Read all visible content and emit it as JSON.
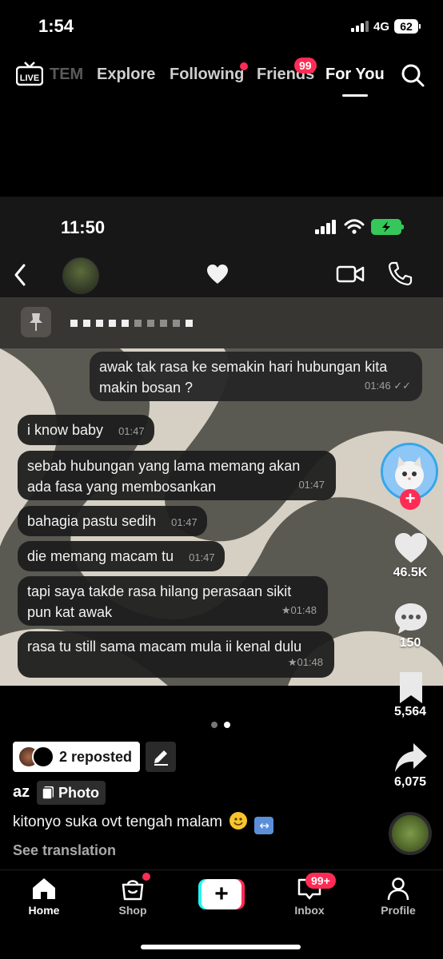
{
  "status_bar": {
    "time": "1:54",
    "network": "4G",
    "battery": "62"
  },
  "top_nav": {
    "live_label": "LIVE",
    "tabs": [
      "TEM",
      "Explore",
      "Following",
      "Friends",
      "For You"
    ],
    "friends_badge": "99",
    "active_tab": "For You"
  },
  "photo_post": {
    "inner_status_time": "11:50",
    "messages": [
      {
        "text": "awak tak rasa ke semakin hari hubungan kita makin bosan ?",
        "time": "01:46",
        "direction": "sent"
      },
      {
        "text": "i know baby",
        "time": "01:47",
        "direction": "received"
      },
      {
        "text": "sebab hubungan yang lama memang akan ada fasa yang membosankan",
        "time": "01:47",
        "direction": "received"
      },
      {
        "text": "bahagia pastu sedih",
        "time": "01:47",
        "direction": "received"
      },
      {
        "text": "die memang macam tu",
        "time": "01:47",
        "direction": "received"
      },
      {
        "text": "tapi saya takde rasa hilang perasaan sikit pun kat awak",
        "time": "★01:48",
        "direction": "received"
      },
      {
        "text": "rasa tu still sama macam mula ii kenal dulu",
        "time": "★01:48",
        "direction": "received"
      }
    ]
  },
  "actions": {
    "likes": "46.5K",
    "comments": "150",
    "saves": "5,564",
    "shares": "6,075"
  },
  "post_info": {
    "repost_label": "2 reposted",
    "username": "az",
    "content_type": "Photo",
    "caption": "kitonyo suka ovt tengah malam",
    "see_translation": "See translation"
  },
  "tabbar": {
    "items": [
      {
        "label": "Home",
        "icon": "home-icon"
      },
      {
        "label": "Shop",
        "icon": "shop-bag-icon"
      },
      {
        "label": "",
        "icon": "create-plus-icon"
      },
      {
        "label": "Inbox",
        "icon": "inbox-icon"
      },
      {
        "label": "Profile",
        "icon": "profile-icon"
      }
    ],
    "inbox_badge": "99+"
  },
  "colors": {
    "accent": "#fe2c55",
    "cyan": "#25f4ee",
    "battery_green": "#35c759"
  }
}
